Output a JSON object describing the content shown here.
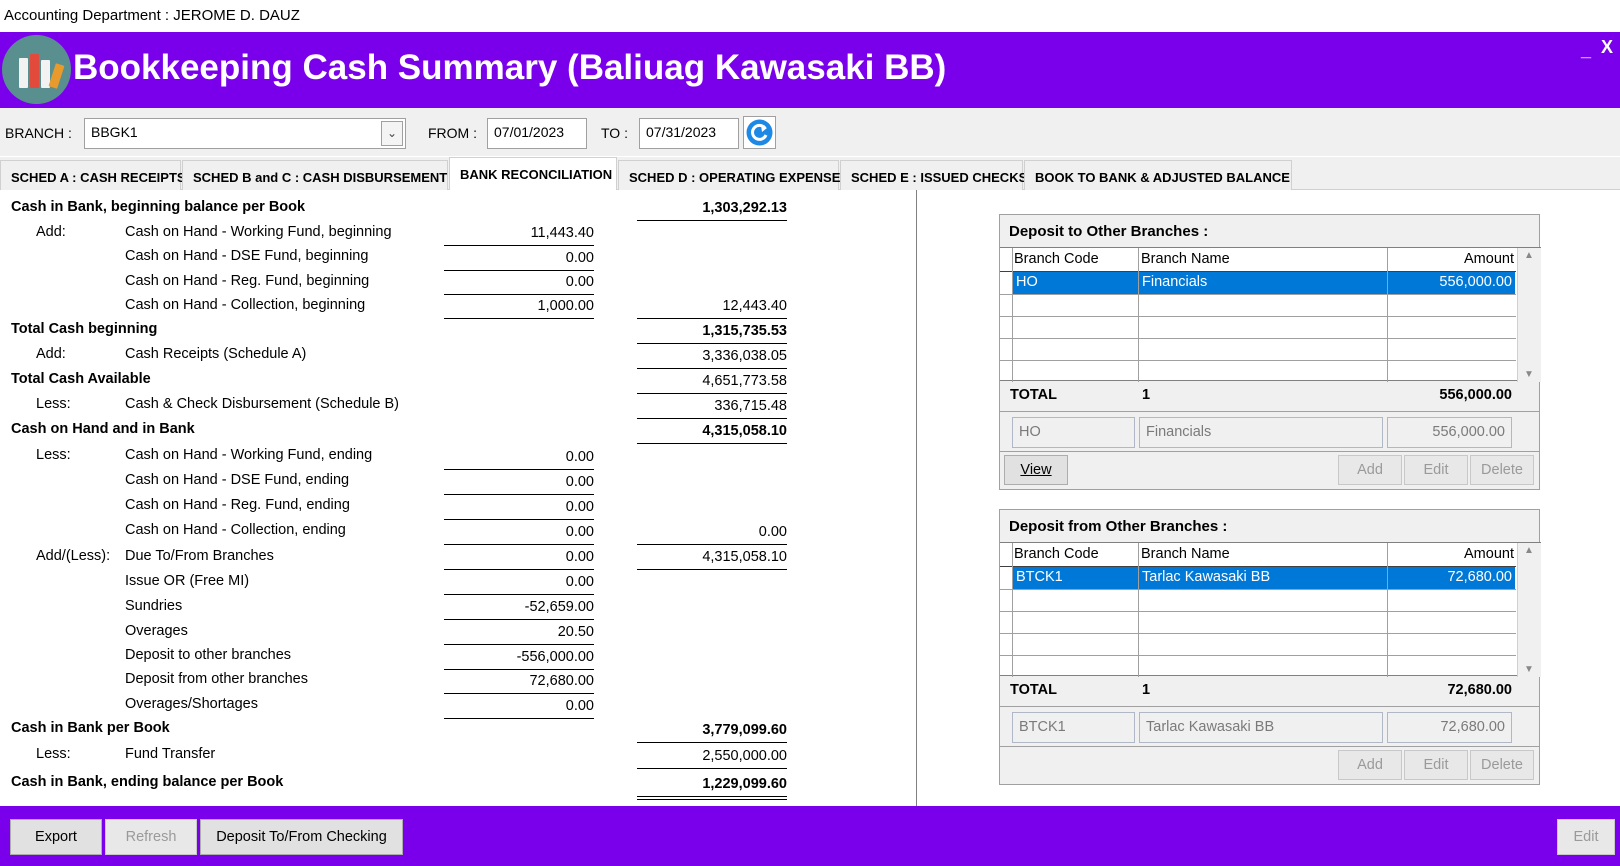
{
  "topbar": {
    "text": "Accounting Department : JEROME D. DAUZ"
  },
  "header": {
    "title": "Bookkeeping Cash Summary (Baliuag Kawasaki BB)",
    "min": "_",
    "close": "X"
  },
  "filters": {
    "branch_label": "BRANCH :",
    "branch_value": "BBGK1",
    "from_label": "FROM :",
    "from_value": "07/01/2023",
    "to_label": "TO :",
    "to_value": "07/31/2023"
  },
  "tabs": [
    "SCHED A : CASH RECEIPTS",
    "SCHED B and C : CASH DISBURSEMENT",
    "BANK RECONCILIATION",
    "SCHED D : OPERATING EXPENSE",
    "SCHED E : ISSUED CHECKS",
    "BOOK TO BANK & ADJUSTED BALANCE"
  ],
  "recon": {
    "begin_label": "Cash in Bank, beginning balance per Book",
    "begin_value": "1,303,292.13",
    "add": "Add:",
    "wf_begin": "Cash on Hand - Working Fund, beginning",
    "wf_begin_v": "11,443.40",
    "dse_begin": "Cash on Hand - DSE Fund, beginning",
    "dse_begin_v": "0.00",
    "reg_begin": "Cash on Hand - Reg. Fund, beginning",
    "reg_begin_v": "0.00",
    "col_begin": "Cash on Hand - Collection, beginning",
    "col_begin_v": "1,000.00",
    "coh_begin_total": "12,443.40",
    "total_begin": "Total Cash beginning",
    "total_begin_v": "1,315,735.53",
    "receipts": "Cash Receipts (Schedule A)",
    "receipts_v": "3,336,038.05",
    "total_avail": "Total Cash Available",
    "total_avail_v": "4,651,773.58",
    "less": "Less:",
    "disb": "Cash & Check Disbursement (Schedule B)",
    "disb_v": "336,715.48",
    "coh_bank": "Cash on Hand and in Bank",
    "coh_bank_v": "4,315,058.10",
    "wf_end": "Cash on Hand - Working Fund, ending",
    "wf_end_v": "0.00",
    "dse_end": "Cash on Hand - DSE Fund, ending",
    "dse_end_v": "0.00",
    "reg_end": "Cash on Hand - Reg. Fund, ending",
    "reg_end_v": "0.00",
    "col_end": "Cash on Hand - Collection, ending",
    "col_end_v": "0.00",
    "coh_end_total": "0.00",
    "addless": "Add/(Less):",
    "due": "Due To/From Branches",
    "due_v": "0.00",
    "due_total": "4,315,058.10",
    "issue_or": "Issue OR (Free MI)",
    "issue_or_v": "0.00",
    "sundries": "Sundries",
    "sundries_v": "-52,659.00",
    "overages": "Overages",
    "overages_v": "20.50",
    "dep_to": "Deposit to other branches",
    "dep_to_v": "-556,000.00",
    "dep_from": "Deposit from other branches",
    "dep_from_v": "72,680.00",
    "ovs": "Overages/Shortages",
    "ovs_v": "0.00",
    "cib_book": "Cash in Bank per Book",
    "cib_book_v": "3,779,099.60",
    "fund_transfer": "Fund Transfer",
    "fund_transfer_v": "2,550,000.00",
    "end_label": "Cash in Bank, ending balance per Book",
    "end_value": "1,229,099.60"
  },
  "deposit_to": {
    "title": "Deposit to Other Branches :",
    "headers": [
      "Branch Code",
      "Branch Name",
      "Amount"
    ],
    "row": {
      "code": "HO",
      "name": "Financials",
      "amount": "556,000.00"
    },
    "total_label": "TOTAL",
    "total_count": "1",
    "total_amount": "556,000.00",
    "edit_code": "HO",
    "edit_name": "Financials",
    "edit_amount": "556,000.00",
    "view": "View",
    "add": "Add",
    "edit": "Edit",
    "delete": "Delete"
  },
  "deposit_from": {
    "title": "Deposit from Other Branches :",
    "headers": [
      "Branch Code",
      "Branch Name",
      "Amount"
    ],
    "row": {
      "code": "BTCK1",
      "name": "Tarlac Kawasaki BB",
      "amount": "72,680.00"
    },
    "total_label": "TOTAL",
    "total_count": "1",
    "total_amount": "72,680.00",
    "edit_code": "BTCK1",
    "edit_name": "Tarlac Kawasaki BB",
    "edit_amount": "72,680.00",
    "add": "Add",
    "edit": "Edit",
    "delete": "Delete"
  },
  "footer": {
    "export": "Export",
    "refresh": "Refresh",
    "deposit_checking": "Deposit To/From Checking",
    "edit": "Edit"
  },
  "colors": {
    "brand": "#7a00ec",
    "selection": "#0078d7"
  }
}
